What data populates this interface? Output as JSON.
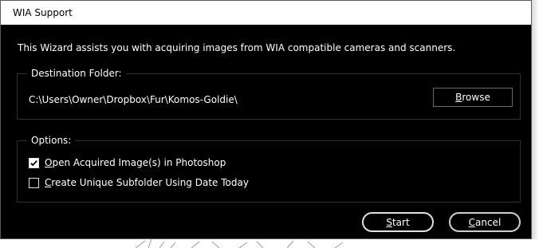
{
  "window": {
    "title": "WIA Support"
  },
  "intro": {
    "text": "This Wizard assists you with acquiring images from WIA compatible cameras and scanners."
  },
  "destination": {
    "legend": "Destination Folder:",
    "path": "C:\\Users\\Owner\\Dropbox\\Fur\\Komos-Goldie\\",
    "browse_label_mnemonic": "B",
    "browse_label_rest": "rowse"
  },
  "options": {
    "legend": "Options:",
    "items": [
      {
        "mnemonic": "O",
        "rest": "pen Acquired Image(s) in Photoshop",
        "checked": true
      },
      {
        "mnemonic": "C",
        "rest": "reate Unique Subfolder Using Date Today",
        "checked": false
      }
    ]
  },
  "footer": {
    "start_mnemonic": "S",
    "start_rest": "tart",
    "cancel_mnemonic": "C",
    "cancel_rest": "ancel"
  }
}
